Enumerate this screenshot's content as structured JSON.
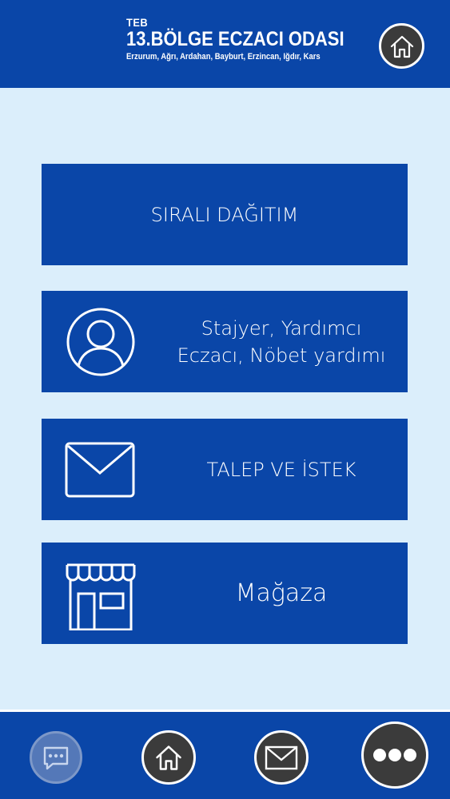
{
  "header": {
    "teb": "TEB",
    "title": "13.BÖLGE ECZACI ODASI",
    "subtitle": "Erzurum, Ağrı, Ardahan, Bayburt, Erzincan, Iğdır, Kars",
    "home_icon": "home-icon"
  },
  "menu": {
    "item1": {
      "label": "SIRALI DAĞITIM"
    },
    "item2": {
      "label_line1": "Stajyer, Yardımcı",
      "label_line2": "Eczacı, Nöbet yardımı",
      "icon": "user-icon"
    },
    "item3": {
      "label": "TALEP VE İSTEK",
      "icon": "envelope-icon"
    },
    "item4": {
      "label": "Mağaza",
      "icon": "store-icon"
    }
  },
  "footer": {
    "icons": [
      "chat-icon",
      "home-icon",
      "envelope-icon",
      "more-icon"
    ]
  },
  "colors": {
    "primary": "#0a46a8",
    "background": "#dbeefb",
    "button_dark": "#3b3b3b"
  }
}
